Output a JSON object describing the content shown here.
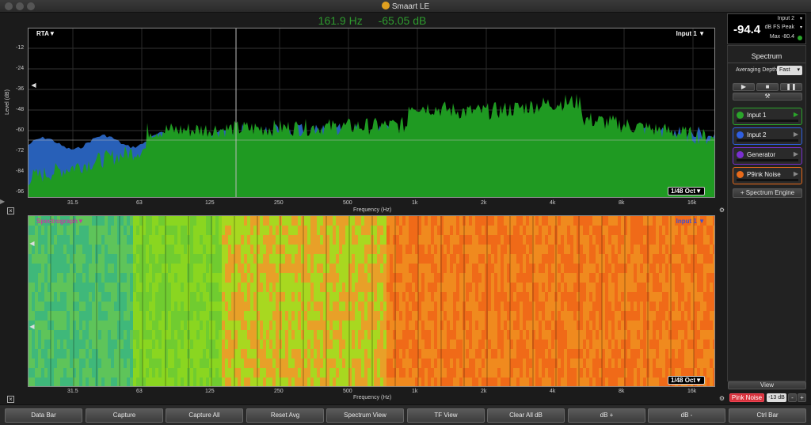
{
  "window": {
    "title": "Smaart LE"
  },
  "readout": {
    "frequency": "161.9 Hz",
    "level": "-65.05 dB"
  },
  "rta": {
    "mode_label": "RTA",
    "input_label": "Input 1",
    "resolution": "1/48 Oct",
    "y_axis_title": "Level (dB)",
    "x_axis_title": "Frequency (Hz)",
    "y_ticks": [
      "-12",
      "-24",
      "-36",
      "-48",
      "-60",
      "-72",
      "-84",
      "-96"
    ],
    "x_ticks": [
      "31.5",
      "63",
      "125",
      "250",
      "500",
      "1k",
      "2k",
      "4k",
      "8k",
      "16k"
    ]
  },
  "spectrograph": {
    "mode_label": "Spectrograph",
    "input_label": "Input 1",
    "resolution": "1/48 Oct",
    "x_axis_title": "Frequency (Hz)",
    "x_ticks": [
      "31.5",
      "63",
      "125",
      "250",
      "500",
      "1k",
      "2k",
      "4k",
      "8k",
      "16k"
    ]
  },
  "meter": {
    "value": "-94.4",
    "input": "Input 2",
    "mode": "dB FS Peak",
    "max": "Max -80.4"
  },
  "sidebar": {
    "title": "Spectrum",
    "averaging_label": "Averaging Depth:",
    "averaging_value": "Fast",
    "channels": [
      {
        "name": "Input 1",
        "color": "#2aa52a"
      },
      {
        "name": "Input 2",
        "color": "#2f5fe0"
      },
      {
        "name": "Generator",
        "color": "#7a2fd0"
      },
      {
        "name": "P9ink Noise",
        "color": "#e86a1a"
      }
    ],
    "add_engine": "+ Spectrum Engine",
    "view": "View",
    "generator": {
      "label": "Pink Noise",
      "level": "-13 dB",
      "minus": "-",
      "plus": "+"
    }
  },
  "toolbar": [
    "Data Bar",
    "Capture",
    "Capture All",
    "Reset Avg",
    "Spectrum View",
    "TF View",
    "Clear All dB",
    "dB +",
    "dB -",
    "Ctrl Bar"
  ]
}
